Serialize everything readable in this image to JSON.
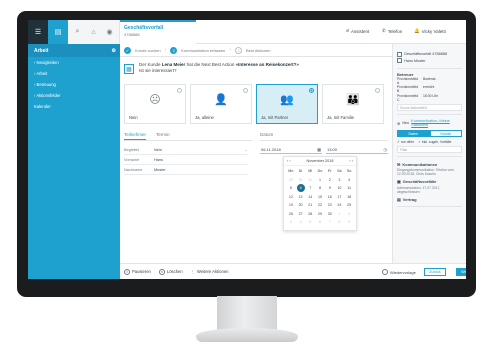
{
  "topbar": {
    "tab_title": "Geschäftsvorfall",
    "tab_sub": "4788888",
    "agent_label": "Assistent",
    "phone_label": "Telefon",
    "user_name": "Vicky Valetti"
  },
  "sidebar": {
    "title": "Arbeit",
    "items": [
      {
        "label": "› Neuigkeiten"
      },
      {
        "label": "› Arbeit"
      },
      {
        "label": "› Betreuung"
      },
      {
        "label": "› Aktionsfelder"
      },
      {
        "label": "Kalender"
      }
    ]
  },
  "steps": [
    {
      "label": "Kunde suchen",
      "state": "done"
    },
    {
      "label": "Kommunikation erfassen",
      "state": "current"
    },
    {
      "label": "Best Aktionen",
      "state": "todo"
    }
  ],
  "question": {
    "prefix": "Der Kunde",
    "customer": "Lena Meier",
    "middle": "hat die Next Best Action",
    "action": "«Interesse an Reisekonzert?»",
    "line2": "Ist sie interessiert?"
  },
  "options": [
    {
      "label": "Nein",
      "glyph": "☹",
      "selected": false
    },
    {
      "label": "Ja, alleine",
      "glyph": "👤",
      "selected": false
    },
    {
      "label": "Ja, mit Partner",
      "glyph": "👥",
      "selected": true
    },
    {
      "label": "Ja, mit Familie",
      "glyph": "👪",
      "selected": false
    }
  ],
  "tabs": {
    "teilnehmer": "Teilnehmer",
    "termin": "Termin"
  },
  "form": {
    "begleitet_label": "Begleitet",
    "begleitet_value": "Nein",
    "vorname_label": "Vorname",
    "vorname_value": "Hans",
    "nachname_label": "Nachname",
    "nachname_value": "Muster"
  },
  "datum": {
    "label": "Datum",
    "date_value": "06.11.2018",
    "time_value": "13:00"
  },
  "calendar": {
    "month": "November 2018",
    "dow": [
      "Mo",
      "Di",
      "Mi",
      "Do",
      "Fr",
      "Sa",
      "So"
    ],
    "weeks": [
      [
        "29",
        "30",
        "31",
        "1",
        "2",
        "3",
        "4"
      ],
      [
        "5",
        "6",
        "7",
        "8",
        "9",
        "10",
        "11"
      ],
      [
        "12",
        "13",
        "14",
        "15",
        "16",
        "17",
        "18"
      ],
      [
        "19",
        "20",
        "21",
        "22",
        "23",
        "24",
        "25"
      ],
      [
        "26",
        "27",
        "28",
        "29",
        "30",
        "1",
        "2"
      ],
      [
        "3",
        "4",
        "5",
        "6",
        "7",
        "8",
        "9"
      ]
    ],
    "selected_day": "6"
  },
  "footer": {
    "pause": "Pausieren",
    "delete": "Löschen",
    "forward": "Weitere Aktionen",
    "resubmit": "Wiedervorlage",
    "back": "Zurück",
    "next": "Weiter NBA"
  },
  "rpanel": {
    "case_title": "Geschäftsvorfall 4788888",
    "client": "Hans Muster",
    "section_title": "Betreuer",
    "grid": [
      [
        "Provisionsfeld A",
        "Bodenst."
      ],
      [
        "Provisionsfeld B",
        "erreicht"
      ],
      [
        "Provisionsfeld C",
        "18:00 Uhr"
      ]
    ],
    "search_placeholder": "Suche Aktionsfeld",
    "new_comm_label": "Neu",
    "new_comm_link": "Kommunikation, Meine Statusfeld",
    "seg_left": "Daten",
    "seg_right": "Kunde",
    "check_a": "nur offen",
    "check_b": "inkl. zugeh. Vorfälle",
    "filter_placeholder": "Filter",
    "comm_title": "Kommunikationen",
    "comm_detail": "Eingangskommunikation: Telefon vom 12.09.2018, Chris Kasche",
    "case2_title": "Geschäftsvorfälle",
    "case2_detail": "Adressmutation: 17.07.2017, abgeschlossen",
    "notes_title": "Vertrag"
  }
}
